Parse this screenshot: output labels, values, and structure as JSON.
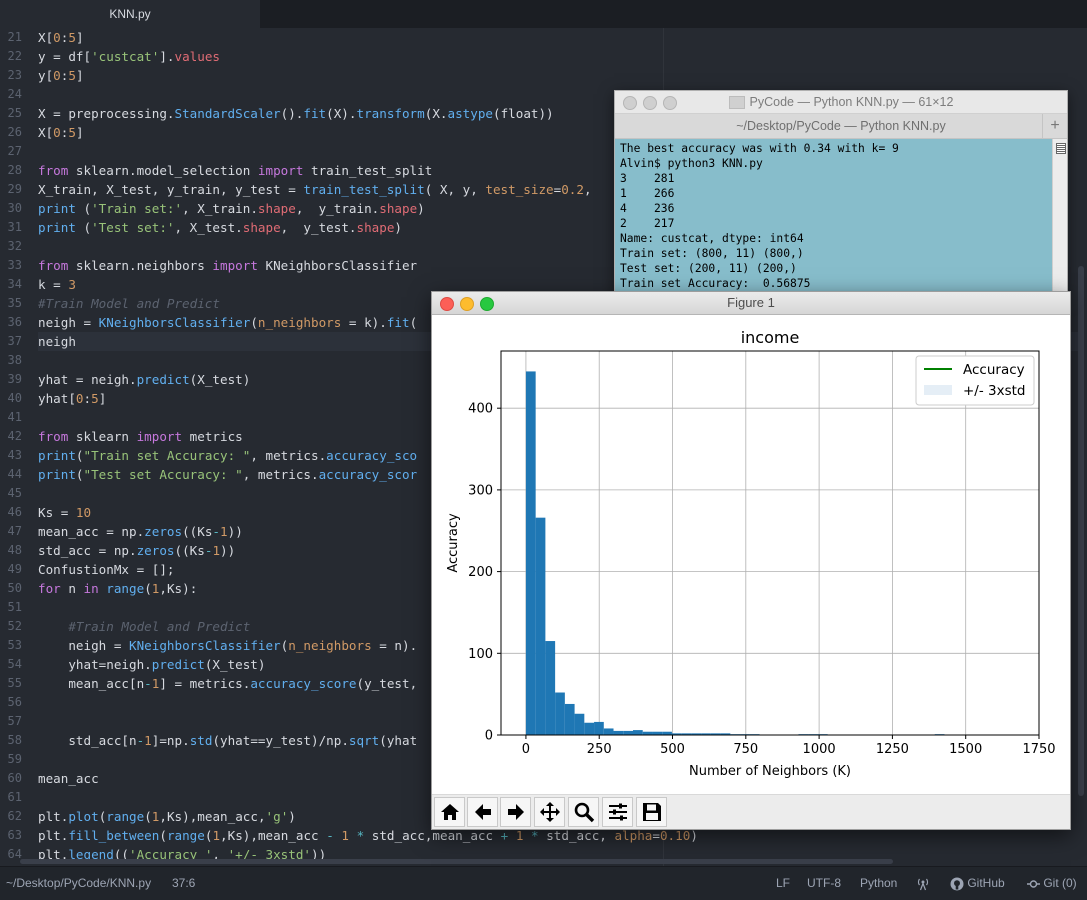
{
  "editor": {
    "tab_title": "KNN.py",
    "lines": [
      {
        "n": "21",
        "html": "X[<span class='n'>0</span>:<span class='n'>5</span>]"
      },
      {
        "n": "22",
        "html": "y = df[<span class='s'>'custcat'</span>].<span class='r'>values</span>"
      },
      {
        "n": "23",
        "html": "y[<span class='n'>0</span>:<span class='n'>5</span>]"
      },
      {
        "n": "24",
        "html": ""
      },
      {
        "n": "25",
        "html": "X = preprocessing.<span class='f'>StandardScaler</span>().<span class='f'>fit</span>(X).<span class='f'>transform</span>(X.<span class='f'>astype</span>(float))"
      },
      {
        "n": "26",
        "html": "X[<span class='n'>0</span>:<span class='n'>5</span>]"
      },
      {
        "n": "27",
        "html": ""
      },
      {
        "n": "28",
        "html": "<span class='k'>from</span> sklearn.model_selection <span class='k'>import</span> train_test_split"
      },
      {
        "n": "29",
        "html": "X_train, X_test, y_train, y_test = <span class='f'>train_test_split</span>( X, y, <span class='n'>test_size</span>=<span class='n'>0.2</span>,"
      },
      {
        "n": "30",
        "html": "<span class='f'>print</span> (<span class='s'>'Train set:'</span>, X_train.<span class='r'>shape</span>,  y_train.<span class='r'>shape</span>)"
      },
      {
        "n": "31",
        "html": "<span class='f'>print</span> (<span class='s'>'Test set:'</span>, X_test.<span class='r'>shape</span>,  y_test.<span class='r'>shape</span>)"
      },
      {
        "n": "32",
        "html": ""
      },
      {
        "n": "33",
        "html": "<span class='k'>from</span> sklearn.neighbors <span class='k'>import</span> KNeighborsClassifier"
      },
      {
        "n": "34",
        "html": "k = <span class='n'>3</span>"
      },
      {
        "n": "35",
        "html": "<span class='c'>#Train Model and Predict</span>"
      },
      {
        "n": "36",
        "html": "neigh = <span class='f'>KNeighborsClassifier</span>(<span class='n'>n_neighbors</span> = k).<span class='f'>fit</span>("
      },
      {
        "n": "37",
        "html": "neigh"
      },
      {
        "n": "38",
        "html": ""
      },
      {
        "n": "39",
        "html": "yhat = neigh.<span class='f'>predict</span>(X_test)"
      },
      {
        "n": "40",
        "html": "yhat[<span class='n'>0</span>:<span class='n'>5</span>]"
      },
      {
        "n": "41",
        "html": ""
      },
      {
        "n": "42",
        "html": "<span class='k'>from</span> sklearn <span class='k'>import</span> metrics"
      },
      {
        "n": "43",
        "html": "<span class='f'>print</span>(<span class='s'>\"Train set Accuracy: \"</span>, metrics.<span class='f'>accuracy_sco</span>"
      },
      {
        "n": "44",
        "html": "<span class='f'>print</span>(<span class='s'>\"Test set Accuracy: \"</span>, metrics.<span class='f'>accuracy_scor</span>"
      },
      {
        "n": "45",
        "html": ""
      },
      {
        "n": "46",
        "html": "Ks = <span class='n'>10</span>"
      },
      {
        "n": "47",
        "html": "mean_acc = np.<span class='f'>zeros</span>((Ks<span class='o'>-</span><span class='n'>1</span>))"
      },
      {
        "n": "48",
        "html": "std_acc = np.<span class='f'>zeros</span>((Ks<span class='o'>-</span><span class='n'>1</span>))"
      },
      {
        "n": "49",
        "html": "ConfustionMx = [];"
      },
      {
        "n": "50",
        "html": "<span class='k'>for</span> n <span class='k'>in</span> <span class='f'>range</span>(<span class='n'>1</span>,Ks):"
      },
      {
        "n": "51",
        "html": ""
      },
      {
        "n": "52",
        "html": "    <span class='c'>#Train Model and Predict</span>"
      },
      {
        "n": "53",
        "html": "    neigh = <span class='f'>KNeighborsClassifier</span>(<span class='n'>n_neighbors</span> = n)."
      },
      {
        "n": "54",
        "html": "    yhat=neigh.<span class='f'>predict</span>(X_test)"
      },
      {
        "n": "55",
        "html": "    mean_acc[n<span class='o'>-</span><span class='n'>1</span>] = metrics.<span class='f'>accuracy_score</span>(y_test,"
      },
      {
        "n": "56",
        "html": ""
      },
      {
        "n": "57",
        "html": ""
      },
      {
        "n": "58",
        "html": "    std_acc[n<span class='o'>-</span><span class='n'>1</span>]=np.<span class='f'>std</span>(yhat==y_test)/np.<span class='f'>sqrt</span>(yhat"
      },
      {
        "n": "59",
        "html": ""
      },
      {
        "n": "60",
        "html": "mean_acc"
      },
      {
        "n": "61",
        "html": ""
      },
      {
        "n": "62",
        "html": "plt.<span class='f'>plot</span>(<span class='f'>range</span>(<span class='n'>1</span>,Ks),mean_acc,<span class='s'>'g'</span>)"
      },
      {
        "n": "63",
        "html": "plt.<span class='f'>fill_between</span>(<span class='f'>range</span>(<span class='n'>1</span>,Ks),mean_acc <span class='o'>-</span> <span class='n'>1</span> <span class='o'>*</span> std_acc,mean_acc <span class='o'>+</span> <span class='n'>1</span> <span class='o'>*</span> std_acc, <span class='n'>alpha</span>=<span class='n'>0.10</span>)"
      },
      {
        "n": "64",
        "html": "plt.<span class='f'>legend</span>((<span class='s'>'Accuracy '</span>, <span class='s'>'+/- 3xstd'</span>))"
      }
    ],
    "current_line": "37"
  },
  "statusbar": {
    "path": "~/Desktop/PyCode/KNN.py",
    "cursor": "37:6",
    "line_ending": "LF",
    "encoding": "UTF-8",
    "grammar": "Python",
    "github": "GitHub",
    "git": "Git (0)"
  },
  "terminal": {
    "title": "PyCode — Python KNN.py — 61×12",
    "tab": "~/Desktop/PyCode — Python KNN.py",
    "lines": [
      "The best accuracy was with 0.34 with k= 9",
      "Alvin$ python3 KNN.py",
      "3    281",
      "1    266",
      "4    236",
      "2    217",
      "Name: custcat, dtype: int64",
      "Train set: (800, 11) (800,)",
      "Test set: (200, 11) (200,)",
      "Train set Accuracy:  0.56875"
    ]
  },
  "figure": {
    "window_title": "Figure 1",
    "toolbar": [
      "home-icon",
      "back-arrow-icon",
      "forward-arrow-icon",
      "pan-icon",
      "zoom-icon",
      "configure-subplots-icon",
      "save-icon"
    ]
  },
  "chart_data": {
    "type": "bar",
    "title": "income",
    "xlabel": "Number of Neighbors (K)",
    "ylabel": "Accuracy",
    "xlim": [
      -85,
      1750
    ],
    "ylim": [
      0,
      470
    ],
    "xticks": [
      0,
      250,
      500,
      750,
      1000,
      1250,
      1500,
      1750
    ],
    "yticks": [
      0,
      100,
      200,
      300,
      400
    ],
    "grid": true,
    "legend": {
      "position": "top-right",
      "entries": [
        "Accuracy",
        "+/- 3xstd"
      ]
    },
    "colors": {
      "bars": "#1f77b4",
      "accuracy_line": "#008000",
      "band": "#e5eef6"
    },
    "bin_width": 33.2,
    "bins_start": 0,
    "values": [
      445,
      266,
      115,
      52,
      38,
      26,
      15,
      16,
      8,
      5,
      5,
      6,
      4,
      4,
      4,
      2,
      2,
      2,
      2,
      2,
      2,
      1,
      1,
      1,
      0,
      0,
      0,
      0,
      1,
      1,
      1,
      0,
      0,
      0,
      0,
      0,
      0,
      0,
      0,
      0,
      0,
      0,
      1,
      0,
      0,
      0,
      0,
      0,
      0,
      0,
      0,
      0,
      0,
      0,
      0,
      0,
      0,
      0,
      0,
      0,
      0,
      0,
      0,
      0,
      0,
      0,
      0,
      0,
      0,
      0,
      0,
      0,
      0,
      0,
      0,
      0,
      0,
      0,
      0,
      0,
      0,
      0,
      0,
      0,
      0,
      0,
      0,
      0,
      0,
      0,
      0,
      0,
      0,
      0,
      0,
      0,
      0,
      0,
      0,
      1
    ]
  }
}
